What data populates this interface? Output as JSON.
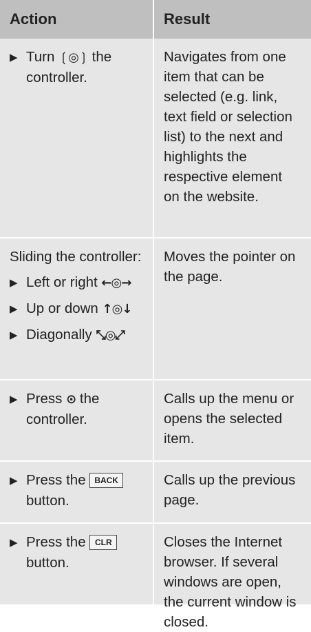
{
  "table": {
    "headers": {
      "action": "Action",
      "result": "Result"
    },
    "rows": [
      {
        "action_parts": [
          "Turn",
          "❲◎❳",
          "the controller."
        ],
        "result": "Navigates from one item that can be selected (e.g. link, text field or selection list) to the next and highlights the respective element on the website."
      },
      {
        "action_intro": "Sliding the controller:",
        "action_steps": [
          {
            "text": "Left or right",
            "symbol": "←◎→"
          },
          {
            "text": "Up or down",
            "symbol": "↑◎↓"
          },
          {
            "text": "Diagonally",
            "symbol": "⤡◎⤢"
          }
        ],
        "result": "Moves the pointer on the page."
      },
      {
        "action_parts": [
          "Press",
          "⊙",
          "the controller."
        ],
        "result": "Calls up the menu or opens the selected item."
      },
      {
        "action_parts": [
          "Press the",
          "BACK",
          "button."
        ],
        "result": "Calls up the previous page."
      },
      {
        "action_parts": [
          "Press the",
          "CLR",
          "button."
        ],
        "result": "Closes the Internet browser. If several windows are open, the current window is closed."
      }
    ]
  }
}
